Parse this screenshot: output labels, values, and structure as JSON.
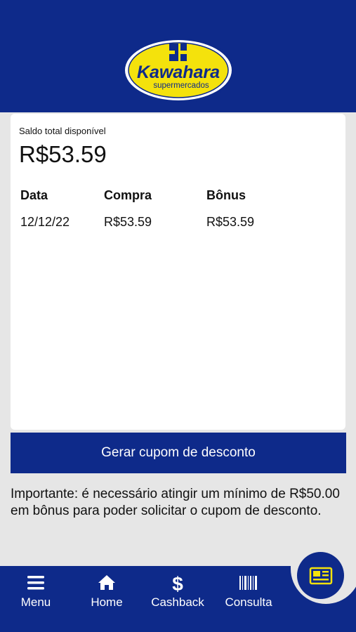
{
  "header": {
    "brand_name": "Kawahara",
    "brand_tagline": "supermercados",
    "logo_icon": "kawahara-logo",
    "background_color": "#0e2a8a",
    "logo_yellow": "#f4e20c"
  },
  "balance": {
    "label": "Saldo total disponível",
    "value": "R$53.59"
  },
  "table": {
    "headers": [
      "Data",
      "Compra",
      "Bônus"
    ],
    "rows": [
      [
        "12/12/22",
        "R$53.59",
        "R$53.59"
      ]
    ]
  },
  "coupon_button": {
    "label": "Gerar cupom de desconto"
  },
  "notice": {
    "text": "Importante: é necessário atingir um mínimo de R$50.00 em bônus para poder solicitar o cupom de desconto."
  },
  "bottom_nav": {
    "items": [
      {
        "label": "Menu",
        "icon": "menu-icon"
      },
      {
        "label": "Home",
        "icon": "home-icon"
      },
      {
        "label": "Cashback",
        "icon": "dollar-icon"
      },
      {
        "label": "Consulta",
        "icon": "barcode-icon"
      }
    ],
    "fab_icon": "newspaper-icon",
    "fab_icon_color": "#f4e20c"
  }
}
